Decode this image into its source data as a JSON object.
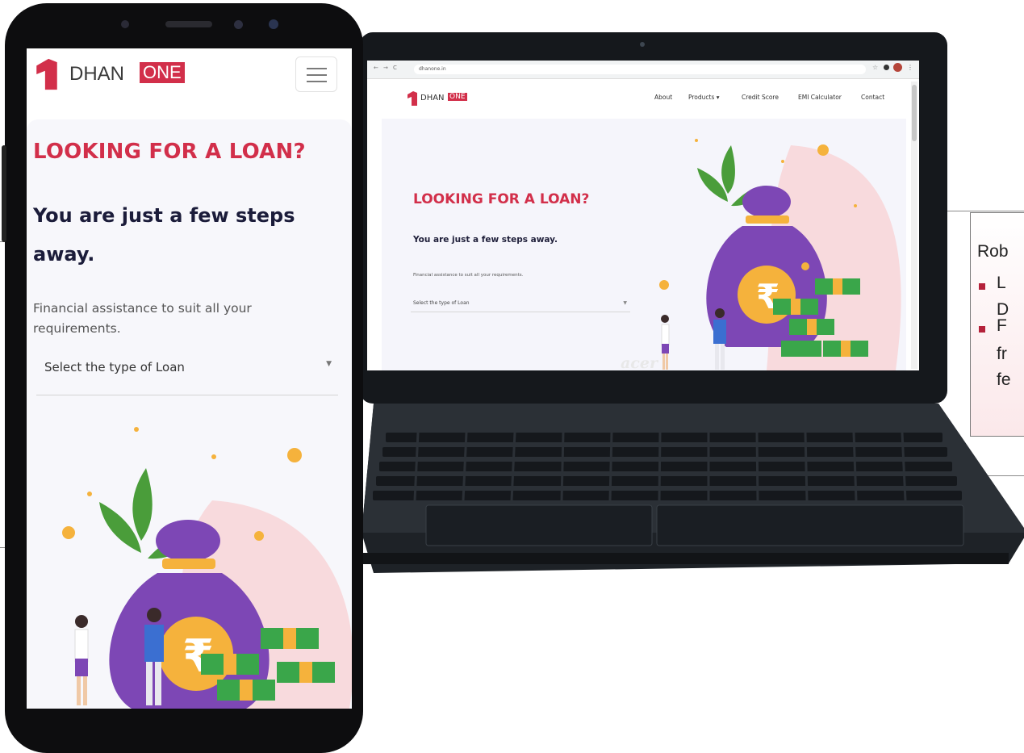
{
  "brand": {
    "name_prefix": "DHAN",
    "name_badge": "ONE",
    "colors": {
      "brand_red": "#d22f4a",
      "navy": "#1b1c3a",
      "bag_purple": "#7d47b5",
      "coin_gold": "#f5b23c",
      "cash_green": "#3aa64a"
    }
  },
  "phone": {
    "menu_icon": "hamburger-icon",
    "heading": "LOOKING FOR A LOAN?",
    "subheading": "You are just a few steps away.",
    "description": "Financial assistance to suit all your requirements.",
    "select_placeholder": "Select the type of Loan",
    "illustration_icon": "rupee-icon"
  },
  "laptop": {
    "url": "dhanone.in",
    "nav": [
      "About",
      "Products ▾",
      "Credit Score",
      "EMI Calculator",
      "Contact"
    ],
    "heading": "LOOKING FOR A LOAN?",
    "subheading": "You are just a few steps away.",
    "description": "Financial assistance to suit all your requirements.",
    "select_placeholder": "Select the type of Loan",
    "device_brand": "acer"
  },
  "callout": {
    "heading": "Rob",
    "items": [
      {
        "lines": [
          "L",
          "D"
        ]
      },
      {
        "lines": [
          "F",
          "fr",
          "fe"
        ]
      }
    ]
  }
}
